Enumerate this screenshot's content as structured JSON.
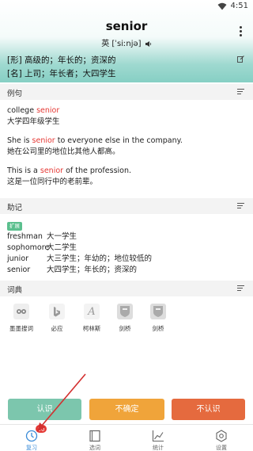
{
  "status": {
    "time": "4:51"
  },
  "word": {
    "text": "senior",
    "phonetic": "英 [ˈsiːnjə]"
  },
  "definitions": [
    "[形] 高级的；年长的；资深的",
    "[名] 上司；年长者；大四学生"
  ],
  "examples": {
    "title": "例句",
    "items": [
      {
        "en_before": "college ",
        "en_hl": "senior",
        "en_after": "",
        "zh": "大学四年级学生"
      },
      {
        "en_before": "She is ",
        "en_hl": "senior",
        "en_after": " to everyone else in the company.",
        "zh": "她在公司里的地位比其他人都高。"
      },
      {
        "en_before": "This is a ",
        "en_hl": "senior",
        "en_after": " of the profession.",
        "zh": "这是一位同行中的老前辈。"
      }
    ]
  },
  "mnemonic": {
    "title": "助记",
    "tag": "扩展",
    "items": [
      {
        "word": "freshman",
        "meaning": "大一学生"
      },
      {
        "word": "sophomore",
        "meaning": "大二学生"
      },
      {
        "word": "junior",
        "meaning": "大三学生；年幼的；地位较低的"
      },
      {
        "word": "senior",
        "meaning": "大四学生；年长的；资深的"
      }
    ]
  },
  "dictionary": {
    "title": "词典",
    "items": [
      {
        "label": "墨墨搜词",
        "icon": "owl-icon"
      },
      {
        "label": "必应",
        "icon": "bing-icon"
      },
      {
        "label": "柯林斯",
        "icon": "collins-icon"
      },
      {
        "label": "剑桥",
        "icon": "cambridge-icon"
      },
      {
        "label": "剑桥",
        "icon": "cambridge-icon"
      }
    ]
  },
  "actions": {
    "know": "认识",
    "unsure": "不确定",
    "unknown": "不认识"
  },
  "colors": {
    "know": "#7cc6ad",
    "unsure": "#f0a43a",
    "unknown": "#e56a3e",
    "accent": "#3a8bd8"
  },
  "tabs": [
    {
      "label": "复习",
      "badge": "50",
      "icon": "clock-icon"
    },
    {
      "label": "选词",
      "icon": "book-icon"
    },
    {
      "label": "统计",
      "icon": "chart-icon"
    },
    {
      "label": "设置",
      "icon": "gear-icon"
    }
  ]
}
